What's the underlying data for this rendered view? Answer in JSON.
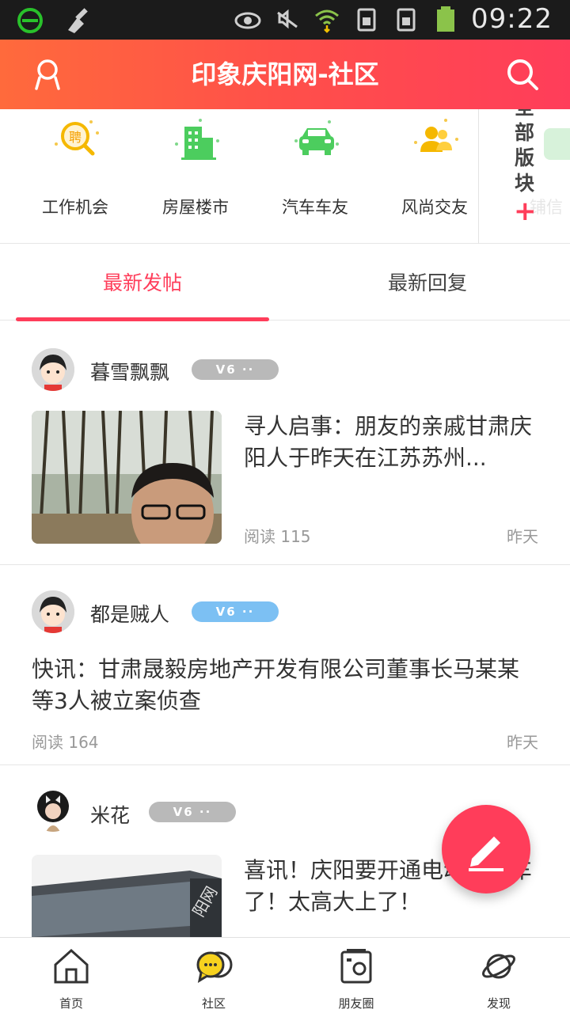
{
  "status_bar": {
    "time": "09:22"
  },
  "header": {
    "title": "印象庆阳网-社区"
  },
  "categories": [
    {
      "label": "工作机会",
      "icon": "recruit-icon",
      "icon_text": "聘"
    },
    {
      "label": "房屋楼市",
      "icon": "building-icon"
    },
    {
      "label": "汽车车友",
      "icon": "car-icon"
    },
    {
      "label": "风尚交友",
      "icon": "friends-icon"
    }
  ],
  "all_sections": {
    "label": "全部版块",
    "ghost_text": "铺信"
  },
  "tabs": {
    "active": "最新发帖",
    "inactive": "最新回复"
  },
  "posts": [
    {
      "username": "暮雪飘飘",
      "badge": "V6 ··",
      "title": "寻人启事：朋友的亲戚甘肃庆阳人于昨天在江苏苏州...",
      "reads": "阅读 115",
      "time": "昨天"
    },
    {
      "username": "都是贼人",
      "badge": "V6 ··",
      "title": "快讯：甘肃晟毅房地产开发有限公司董事长马某某等3人被立案侦查",
      "reads": "阅读 164",
      "time": "昨天"
    },
    {
      "username": "米花",
      "badge": "V6 ··",
      "title": "喜讯！庆阳要开通电动公交车了！太高大上了！"
    }
  ],
  "bottom_nav": [
    {
      "label": "首页",
      "icon": "home-icon"
    },
    {
      "label": "社区",
      "icon": "community-icon"
    },
    {
      "label": "朋友圈",
      "icon": "moments-icon"
    },
    {
      "label": "发现",
      "icon": "planet-icon"
    }
  ],
  "colors": {
    "accent": "#ff3d5a",
    "header_start": "#ff6a3c",
    "header_end": "#ff3d5a",
    "badge_gray": "#b9b9b9",
    "badge_blue": "#7cc0f3"
  }
}
